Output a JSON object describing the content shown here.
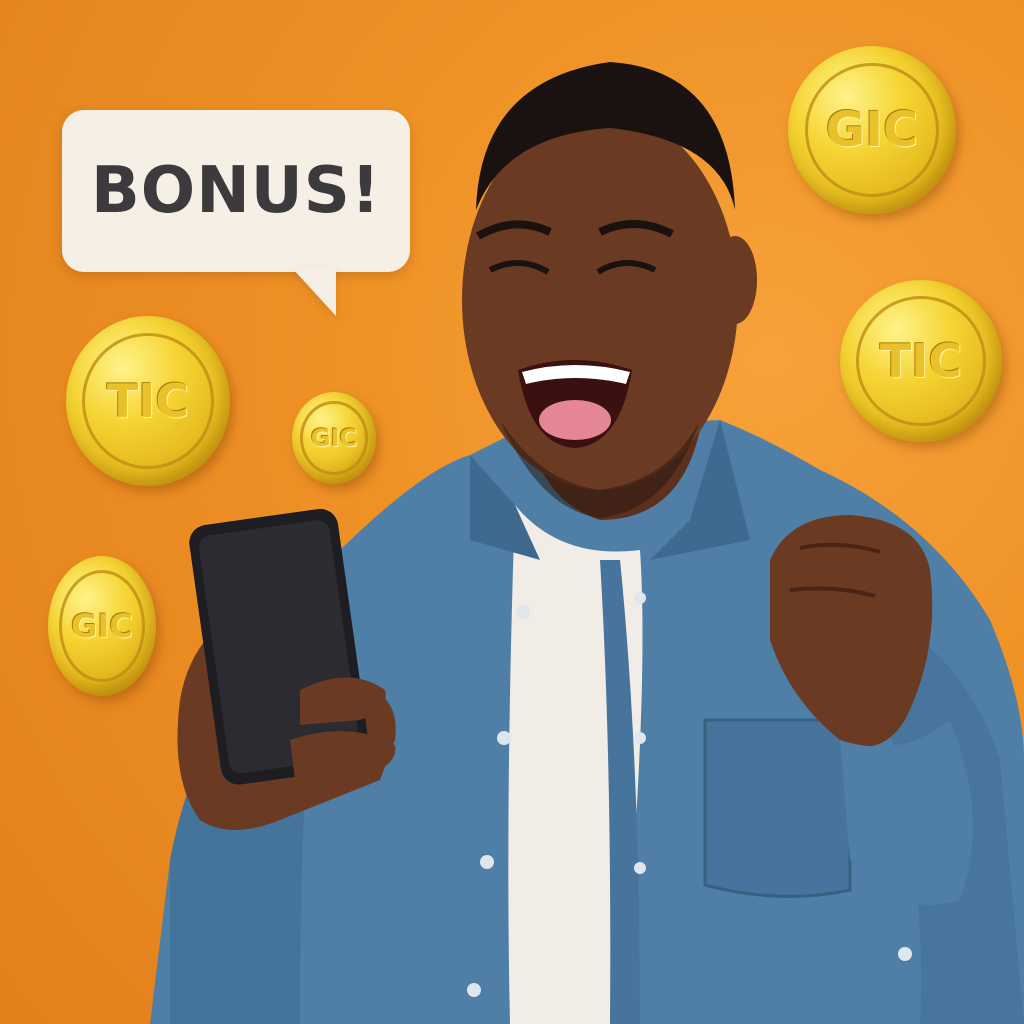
{
  "speech_bubble": {
    "text": "BONUS!"
  },
  "coins": [
    {
      "label": "GIC"
    },
    {
      "label": "TIC"
    },
    {
      "label": "TIC"
    },
    {
      "label": "GIC"
    },
    {
      "label": "GIC"
    }
  ],
  "colors": {
    "background": "#ef9226",
    "bubble": "#f6efe6",
    "bubble_text": "#3c3a3c",
    "coin_gold": "#f5d433",
    "shirt_denim": "#4f7fa7",
    "tshirt": "#f1ede6",
    "skin": "#6b3a22",
    "phone": "#1e1e22"
  }
}
